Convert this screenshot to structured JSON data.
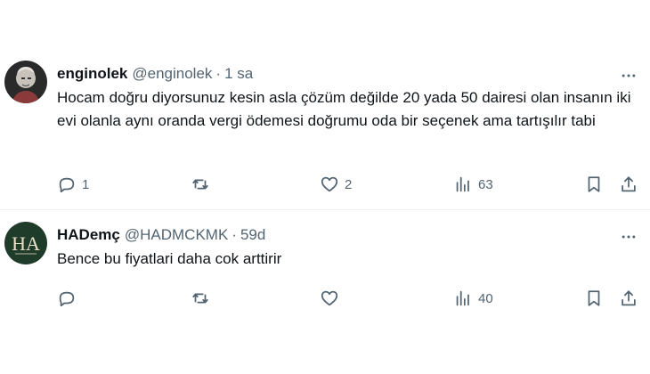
{
  "tweets": [
    {
      "display_name": "enginolek",
      "handle": "@enginolek",
      "separator": "·",
      "time": "1 sa",
      "text": "Hocam doğru diyorsunuz kesin asla çözüm değilde 20 yada 50 dairesi olan insanın iki evi olanla aynı oranda vergi ödemesi doğrumu oda bir seçenek ama tartışılır tabi",
      "replies": "1",
      "retweets": "",
      "likes": "2",
      "views": "63",
      "avatar_icon": "portrait-photo"
    },
    {
      "display_name": "HADemç",
      "handle": "@HADMCKMK",
      "separator": "·",
      "time": "59d",
      "text": "Bence bu fiyatlari daha cok arttirir",
      "replies": "",
      "retweets": "",
      "likes": "",
      "views": "40",
      "avatar_icon": "ha-monogram",
      "avatar_letters": "HA"
    }
  ],
  "icons": {
    "more": "more-horizontal-icon",
    "reply": "reply-icon",
    "retweet": "retweet-icon",
    "like": "heart-icon",
    "views": "views-icon",
    "bookmark": "bookmark-icon",
    "share": "share-icon"
  },
  "colors": {
    "text": "#0f1419",
    "secondary": "#536471",
    "divider": "#eff3f4",
    "avatar2_bg": "#1f3b2a"
  }
}
